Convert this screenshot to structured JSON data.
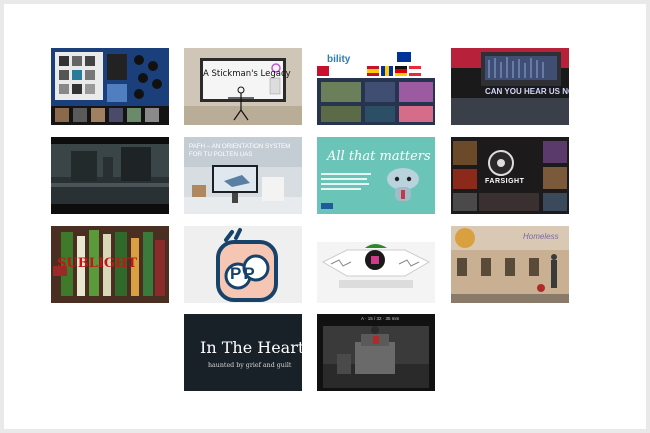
{
  "gallery": {
    "accent": "#ffffff",
    "tiles": [
      {
        "key": "t1",
        "label": ""
      },
      {
        "key": "t2",
        "label": "A Stickman's Legacy"
      },
      {
        "key": "t3",
        "label": "bility"
      },
      {
        "key": "t4",
        "label": "CAN YOU HEAR US NOW?"
      },
      {
        "key": "t5",
        "label": ""
      },
      {
        "key": "t6",
        "label": "PAFH – AN ORIENTATION SYSTEM FOR TU POLTEN UAS"
      },
      {
        "key": "t7",
        "label": "All that matters"
      },
      {
        "key": "t8",
        "label": "FARSIGHT"
      },
      {
        "key": "t9",
        "label": "SUBLIGHT"
      },
      {
        "key": "t10",
        "label": "PP"
      },
      {
        "key": "t11",
        "label": ""
      },
      {
        "key": "t12",
        "label": "Homeless"
      },
      {
        "key": "t13",
        "label": "In The Heart",
        "sub": "haunted by grief and guilt"
      },
      {
        "key": "t14",
        "label": "A · 15 / 32 · 35 mm"
      }
    ]
  }
}
